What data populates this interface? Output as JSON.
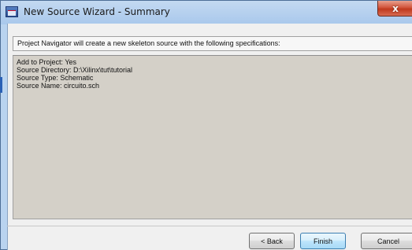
{
  "window": {
    "title": "New Source Wizard - Summary",
    "close_glyph": "x"
  },
  "header": {
    "text": "Project Navigator will create a new skeleton source with the following specifications:"
  },
  "summary": {
    "lines": [
      "Add to Project: Yes",
      "Source Directory: D:\\Xilinx\\tut\\tutorial",
      "Source Type: Schematic",
      "Source Name: circuito.sch"
    ]
  },
  "buttons": {
    "back": "< Back",
    "finish": "Finish",
    "cancel": "Cancel"
  },
  "colors": {
    "titlebar": "#b9d3ef",
    "close": "#c0391e",
    "summary_bg": "#d4d0c8",
    "default_button": "#bee6fd"
  },
  "icons": {
    "app": "xilinx-app-icon",
    "close": "close-icon"
  }
}
